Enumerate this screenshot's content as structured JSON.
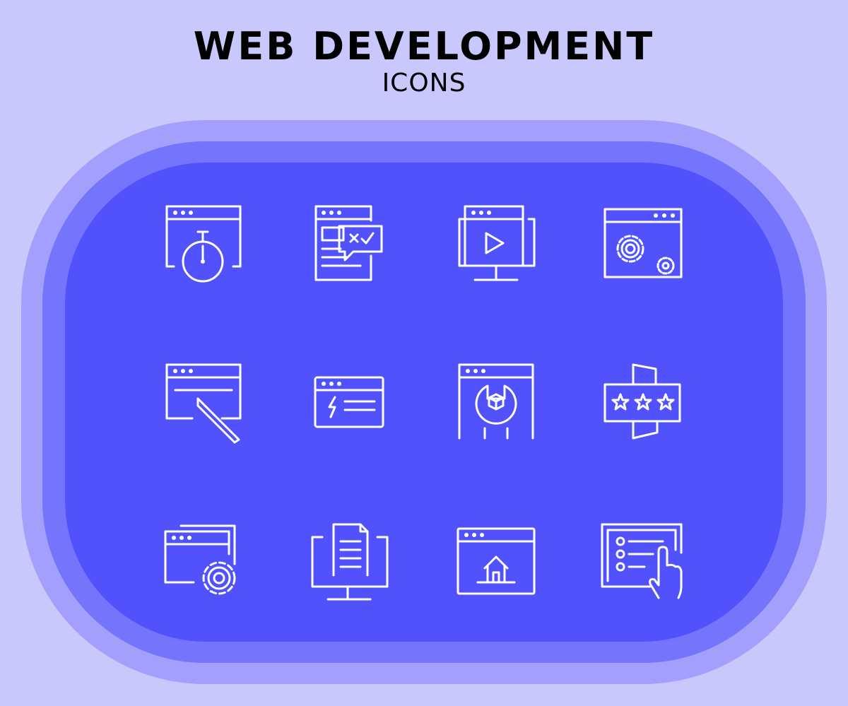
{
  "header": {
    "title": "WEB DEVELOPMENT",
    "subtitle": "ICONS"
  },
  "colors": {
    "background": "#c8c8fc",
    "panel_outer": "#a2a0fc",
    "panel_middle": "#7474fc",
    "panel_inner": "#5152fc",
    "icon_stroke": "#ffffff"
  },
  "icons": [
    "browser-stopwatch-icon",
    "document-chat-check-icon",
    "monitor-video-play-icon",
    "browser-gears-icon",
    "browser-pencil-icon",
    "browser-lightning-icon",
    "browser-wrench-icon",
    "ribbon-three-stars-icon",
    "windows-gear-icon",
    "monitor-document-icon",
    "browser-home-icon",
    "tablet-list-touch-icon"
  ]
}
